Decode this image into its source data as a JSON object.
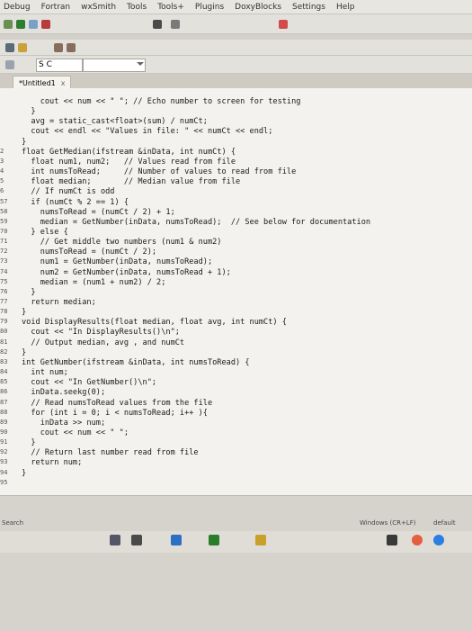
{
  "menu": [
    "Debug",
    "Fortran",
    "wxSmith",
    "Tools",
    "Tools+",
    "Plugins",
    "DoxyBlocks",
    "Settings",
    "Help"
  ],
  "toolbar": {
    "search_text": "S C"
  },
  "tabs": [
    {
      "label": "*Untitled1",
      "close": "x"
    }
  ],
  "code": {
    "lines": [
      {
        "num": "",
        "text": "    cout << num << \" \"; // Echo number to screen for testing"
      },
      {
        "num": "",
        "text": "  }"
      },
      {
        "num": "",
        "text": "  avg = static_cast<float>(sum) / numCt;"
      },
      {
        "num": "",
        "text": "  cout << endl << \"Values in file: \" << numCt << endl;"
      },
      {
        "num": "",
        "text": "}"
      },
      {
        "num": "2",
        "text": "float GetMedian(ifstream &inData, int numCt) {"
      },
      {
        "num": "3",
        "text": "  float num1, num2;   // Values read from file"
      },
      {
        "num": "4",
        "text": "  int numsToRead;     // Number of values to read from file"
      },
      {
        "num": "5",
        "text": "  float median;       // Median value from file"
      },
      {
        "num": "6",
        "text": "  // If numCt is odd"
      },
      {
        "num": "57",
        "text": "  if (numCt % 2 == 1) {"
      },
      {
        "num": "58",
        "text": "    numsToRead = (numCt / 2) + 1;"
      },
      {
        "num": "59",
        "text": "    median = GetNumber(inData, numsToRead);  // See below for documentation"
      },
      {
        "num": "70",
        "text": "  } else {"
      },
      {
        "num": "71",
        "text": "    // Get middle two numbers (num1 & num2)"
      },
      {
        "num": "72",
        "text": "    numsToRead = (numCt / 2);"
      },
      {
        "num": "73",
        "text": "    num1 = GetNumber(inData, numsToRead);"
      },
      {
        "num": "74",
        "text": "    num2 = GetNumber(inData, numsToRead + 1);"
      },
      {
        "num": "75",
        "text": "    median = (num1 + num2) / 2;"
      },
      {
        "num": "76",
        "text": "  }"
      },
      {
        "num": "77",
        "text": "  return median;"
      },
      {
        "num": "78",
        "text": "}"
      },
      {
        "num": "79",
        "text": "void DisplayResults(float median, float avg, int numCt) {"
      },
      {
        "num": "80",
        "text": "  cout << \"In DisplayResults()\\n\";"
      },
      {
        "num": "81",
        "text": "  // Output median, avg , and numCt"
      },
      {
        "num": "82",
        "text": "}"
      },
      {
        "num": "83",
        "text": "int GetNumber(ifstream &inData, int numsToRead) {"
      },
      {
        "num": "84",
        "text": "  int num;"
      },
      {
        "num": "85",
        "text": "  cout << \"In GetNumber()\\n\";"
      },
      {
        "num": "86",
        "text": "  inData.seekg(0);"
      },
      {
        "num": "87",
        "text": "  // Read numsToRead values from the file"
      },
      {
        "num": "88",
        "text": "  for (int i = 0; i < numsToRead; i++ ){"
      },
      {
        "num": "89",
        "text": "    inData >> num;"
      },
      {
        "num": "90",
        "text": "    cout << num << \" \";"
      },
      {
        "num": "91",
        "text": "  }"
      },
      {
        "num": "92",
        "text": "  // Return last number read from file"
      },
      {
        "num": "93",
        "text": "  return num;"
      },
      {
        "num": "94",
        "text": "}"
      },
      {
        "num": "95",
        "text": ""
      }
    ]
  },
  "status": {
    "left": "Search",
    "encoding": "Windows (CR+LF)",
    "mode": "default"
  }
}
